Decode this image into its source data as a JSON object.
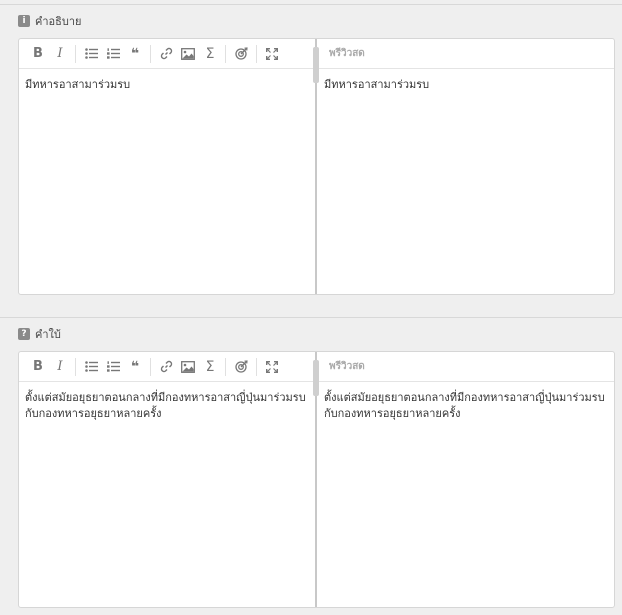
{
  "sections": [
    {
      "badge": "i",
      "label": "คำอธิบาย",
      "preview_label": "พรีวิวสด",
      "content": "มีทหารอาสามาร่วมรบ",
      "preview": "มีทหารอาสามาร่วมรบ"
    },
    {
      "badge": "?",
      "label": "คำใบ้",
      "preview_label": "พรีวิวสด",
      "content": "ตั้งแต่สมัยอยุธยาตอนกลางที่มีกองทหารอาสาญี่ปุ่นมาร่วมรบกับกองทหารอยุธยาหลายครั้ง",
      "preview": "ตั้งแต่สมัยอยุธยาตอนกลางที่มีกองทหารอาสาญี่ปุ่นมาร่วมรบกับกองทหารอยุธยาหลายครั้ง"
    }
  ],
  "toolbar": {
    "bold": "B",
    "italic": "I",
    "quote": "❝",
    "sum": "Σ"
  },
  "colors": {
    "icon": "#777777",
    "badge": "#8a8a8a",
    "border": "#d6d6d6"
  }
}
